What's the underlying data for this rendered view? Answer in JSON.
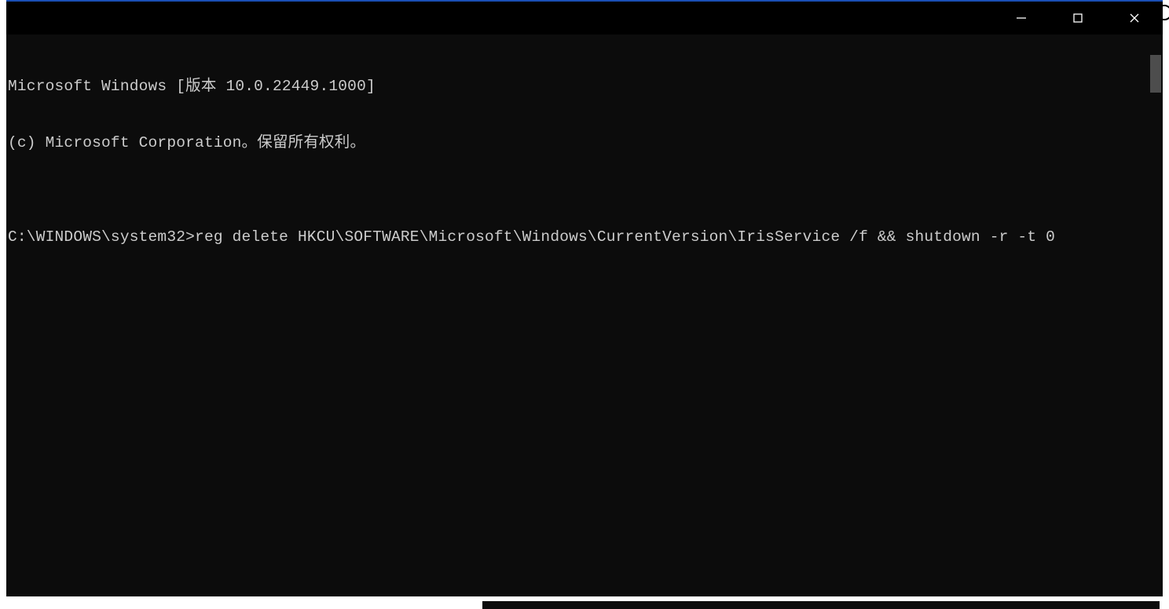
{
  "terminal": {
    "line1": "Microsoft Windows [版本 10.0.22449.1000]",
    "line2": "(c) Microsoft Corporation。保留所有权利。",
    "blank": "",
    "prompt": "C:\\WINDOWS\\system32>",
    "command": "reg delete HKCU\\SOFTWARE\\Microsoft\\Windows\\CurrentVersion\\IrisService /f && shutdown -r -t 0"
  }
}
